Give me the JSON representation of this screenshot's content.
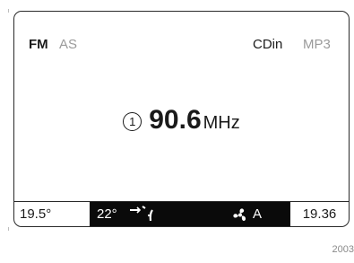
{
  "header": {
    "band": "FM",
    "as_label": "AS",
    "cdin_label": "CDin",
    "mp3_label": "MP3"
  },
  "station": {
    "preset": "1",
    "frequency": "90.6",
    "unit": "MHz"
  },
  "status_bar": {
    "outside_temp": "19.5°",
    "set_temp": "22°",
    "auto_label": "A",
    "clock": "19.36"
  },
  "footer": {
    "code": "2003"
  },
  "icons": {
    "preset": "preset-circle-icon",
    "airflow": "airflow-distribution-icon",
    "fan": "fan-icon"
  }
}
